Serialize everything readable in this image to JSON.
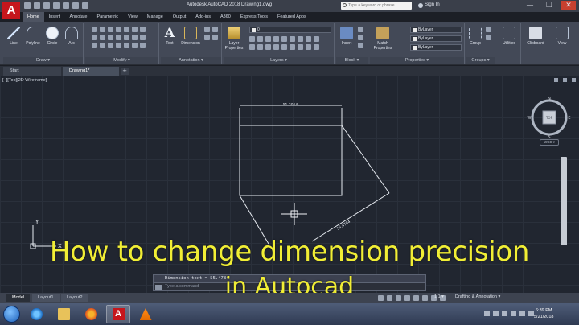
{
  "titlebar": {
    "window_title": "Autodesk AutoCAD 2018    Drawing1.dwg",
    "search_placeholder": "Type a keyword or phrase",
    "signin": "Sign In",
    "minimize": "—",
    "maximize": "❐",
    "close": "✕"
  },
  "app_logo": "A",
  "ribbon_tabs": [
    "Home",
    "Insert",
    "Annotate",
    "Parametric",
    "View",
    "Manage",
    "Output",
    "Add-ins",
    "A360",
    "Express Tools",
    "Featured Apps"
  ],
  "ribbon": {
    "draw": {
      "title": "Draw ▾",
      "tools": [
        "Line",
        "Polyline",
        "Circle",
        "Arc"
      ]
    },
    "modify": {
      "title": "Modify ▾"
    },
    "annotation": {
      "title": "Annotation ▾",
      "tools": [
        "Text",
        "Dimension"
      ]
    },
    "layers": {
      "title": "Layers ▾",
      "tools": [
        "Layer Properties"
      ],
      "layer_value": "0"
    },
    "block": {
      "title": "Block ▾",
      "tools": [
        "Insert"
      ]
    },
    "properties": {
      "title": "Properties ▾",
      "tools": [
        "Match Properties"
      ],
      "bylayer": [
        "ByLayer",
        "ByLayer",
        "ByLayer"
      ]
    },
    "groups": {
      "title": "Groups ▾",
      "tools": [
        "Group"
      ]
    },
    "utilities": {
      "tools": [
        "Utilities"
      ]
    },
    "clipboard": {
      "tools": [
        "Clipboard"
      ]
    },
    "view": {
      "tools": [
        "View"
      ]
    }
  },
  "file_tabs": [
    "Start",
    "Drawing1*"
  ],
  "new_tab": "+",
  "viewport_label": "[−][Top][2D Wireframe]",
  "drawing": {
    "dim_top": "51.2014",
    "dim_diag": "55.4784"
  },
  "viewcube": {
    "n": "N",
    "s": "S",
    "e": "E",
    "w": "W",
    "face": "TOP",
    "wcs": "WCS ▾"
  },
  "ucs": {
    "x": "X",
    "y": "Y"
  },
  "command": {
    "history": "Dimension text = 55.4784",
    "prompt": "Type a command"
  },
  "caption": {
    "line1": "How to change dimension precision",
    "line2": "in Autocad"
  },
  "layout_tabs": [
    "Model",
    "Layout1",
    "Layout2"
  ],
  "status": {
    "scale": "1:1 ▾",
    "workspace": "Drafting & Annotation ▾"
  },
  "clock": {
    "time": "6:39 PM",
    "date": "5/21/2018"
  },
  "colors": {
    "autocad_red": "#c6161c",
    "caption_yellow": "#f1ee35",
    "canvas_bg": "#212630",
    "geometry_white": "#e8ecf2"
  }
}
